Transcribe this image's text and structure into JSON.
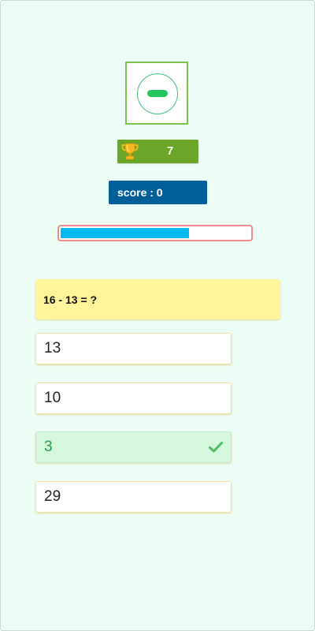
{
  "operation": {
    "icon": "minus-icon",
    "accent_color": "#22c55e"
  },
  "trophy": {
    "icon": "trophy-icon",
    "count": "7",
    "color": "#6aa628"
  },
  "score": {
    "label": "score : 0",
    "color": "#005f99"
  },
  "progress": {
    "fraction": 0.68,
    "fill_color": "#00b9f2",
    "border_color": "#f08a90"
  },
  "question": {
    "text": "16 - 13 = ?"
  },
  "answers": [
    {
      "label": "13",
      "state": "default"
    },
    {
      "label": "10",
      "state": "default"
    },
    {
      "label": "3",
      "state": "correct",
      "icon": "check-icon"
    },
    {
      "label": "29",
      "state": "default"
    }
  ]
}
